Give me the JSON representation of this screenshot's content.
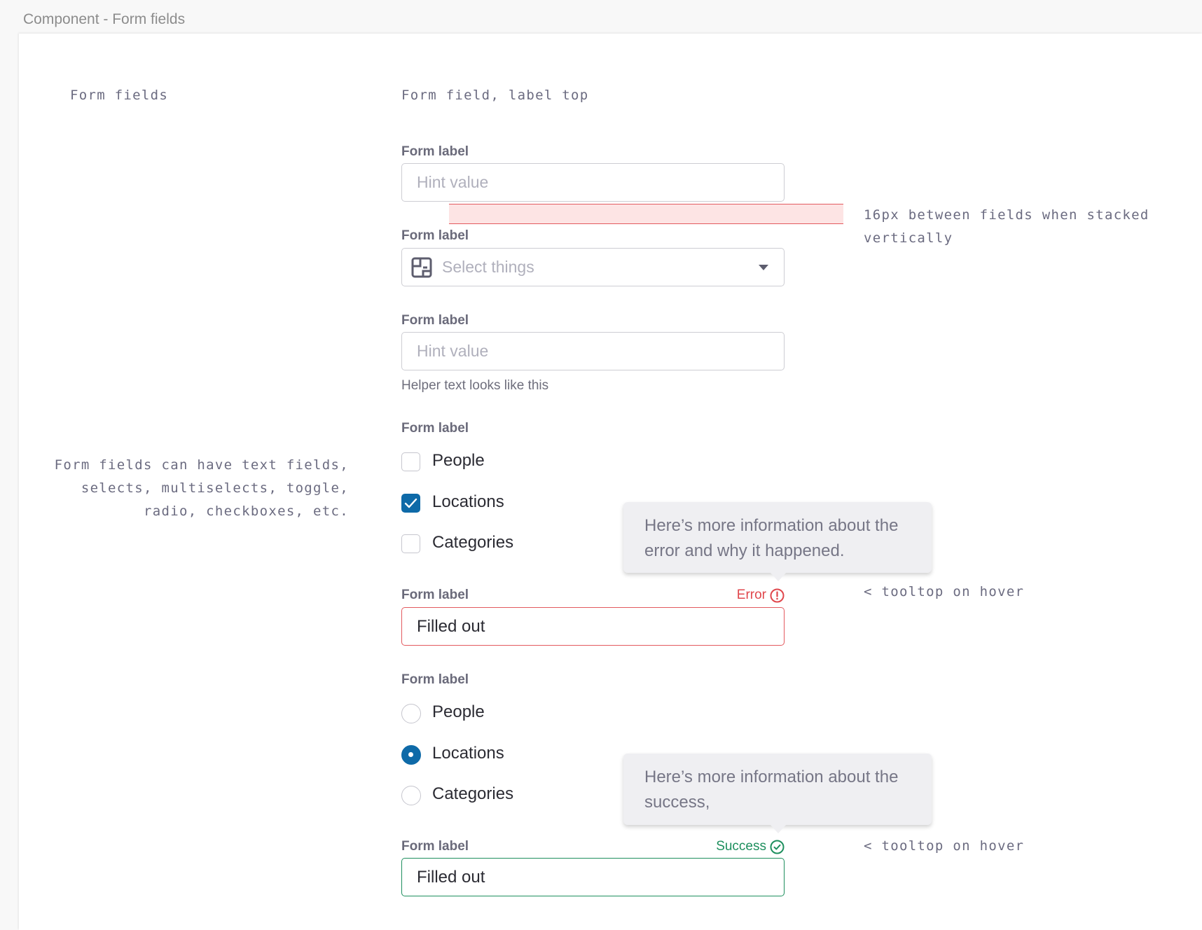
{
  "window": {
    "title": "Component - Form fields"
  },
  "section": {
    "title": "Form fields",
    "subtitle": "Form field, label top",
    "description": "Form fields can have text fields,\nselects, multiselects, toggle,\nradio, checkboxes, etc."
  },
  "annotations": {
    "spacing": "16px between fields when stacked\nvertically",
    "tooltip_error": "< tooltop on hover",
    "tooltip_success": "< tooltop on hover"
  },
  "fields": {
    "text1": {
      "label": "Form label",
      "placeholder": "Hint value"
    },
    "select": {
      "label": "Form label",
      "placeholder": "Select things",
      "icon": "floorplan-icon"
    },
    "text2": {
      "label": "Form label",
      "placeholder": "Hint value",
      "helper": "Helper text looks like this"
    },
    "checkboxes": {
      "label": "Form label",
      "options": [
        {
          "label": "People",
          "checked": false
        },
        {
          "label": "Locations",
          "checked": true
        },
        {
          "label": "Categories",
          "checked": false
        }
      ]
    },
    "error": {
      "label": "Form label",
      "value": "Filled out",
      "status": "Error",
      "tooltip": "Here’s more information about the error and why it happened."
    },
    "radios": {
      "label": "Form label",
      "options": [
        {
          "label": "People",
          "selected": false
        },
        {
          "label": "Locations",
          "selected": true
        },
        {
          "label": "Categories",
          "selected": false
        }
      ]
    },
    "success": {
      "label": "Form label",
      "value": "Filled out",
      "status": "Success",
      "tooltip": "Here’s more information about the success,"
    }
  },
  "colors": {
    "accent": "#0e6aa8",
    "error": "#e35a5f",
    "success": "#1e8f5e",
    "spacer_fill": "#fde4e4"
  }
}
